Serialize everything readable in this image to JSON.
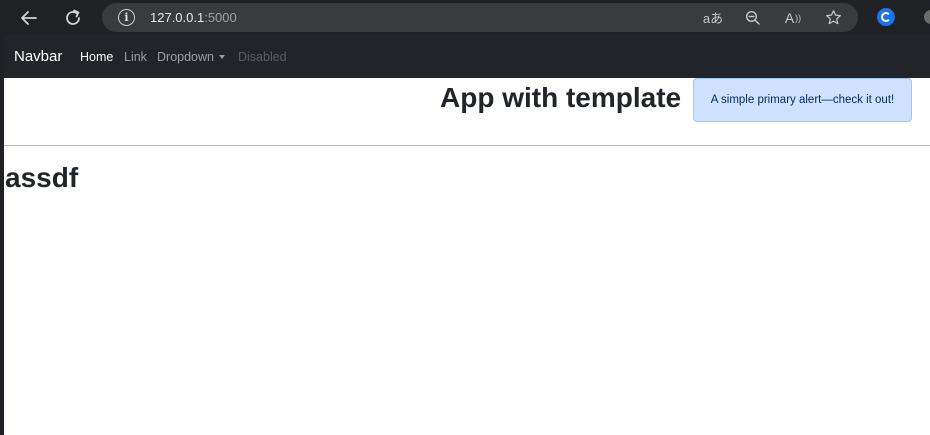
{
  "browser": {
    "url_host": "127.0.0.1",
    "url_port": ":5000",
    "info_icon": "info-icon",
    "read_aloud_text": "aあ",
    "zoom_icon": "zoom-out-icon",
    "font_icon_text": "A",
    "favorite_icon": "star-icon",
    "extension_icon": "shazam-extension-icon"
  },
  "navbar": {
    "brand": "Navbar",
    "links": {
      "home": "Home",
      "link": "Link",
      "dropdown": "Dropdown",
      "disabled": "Disabled"
    },
    "background": "#212529"
  },
  "header": {
    "title": "App with template"
  },
  "alert": {
    "text": "A simple primary alert—check it out!",
    "background": "#cfe2ff",
    "border": "#9ec5fe",
    "color": "#052c65"
  },
  "content": {
    "heading": "assdf"
  }
}
